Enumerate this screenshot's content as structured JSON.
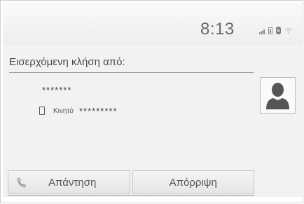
{
  "status_bar": {
    "clock": "8:13",
    "icons": [
      "signal-icon",
      "battery-icon",
      "bluetooth-icon",
      "wifi-icon"
    ]
  },
  "call": {
    "heading": "Εισερχόμενη κλήση από:",
    "caller_name": "*******",
    "phone_type": "Κινητό",
    "phone_number": "*********",
    "avatar_icon": "person-silhouette-icon"
  },
  "actions": {
    "answer_label": "Απάντηση",
    "answer_icon": "phone-handset-icon",
    "reject_label": "Απόρριψη"
  },
  "colors": {
    "screen_background": "#f2f2f2",
    "text": "#4a4a4a",
    "avatar": "#555555"
  }
}
